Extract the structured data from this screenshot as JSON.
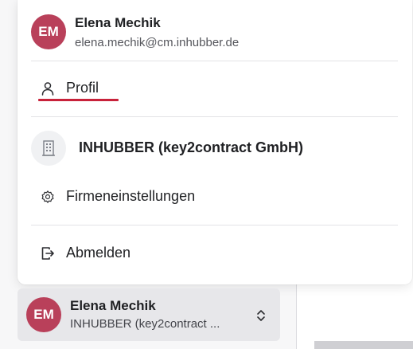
{
  "user": {
    "initials": "EM",
    "name": "Elena Mechik",
    "email": "elena.mechik@cm.inhubber.de"
  },
  "menu": {
    "profile_label": "Profil",
    "organization_name": "INHUBBER (key2contract GmbH)",
    "company_settings_label": "Firmeneinstellungen",
    "logout_label": "Abmelden"
  },
  "switcher": {
    "initials": "EM",
    "name": "Elena Mechik",
    "organization": "INHUBBER (key2contract ..."
  },
  "icons": {
    "profile": "user-icon",
    "organization": "building-icon",
    "settings": "gear-icon",
    "logout": "logout-icon",
    "switcher": "chevron-up-down-icon"
  },
  "colors": {
    "avatar": "#b9405a",
    "active_underline": "#c8223a"
  }
}
